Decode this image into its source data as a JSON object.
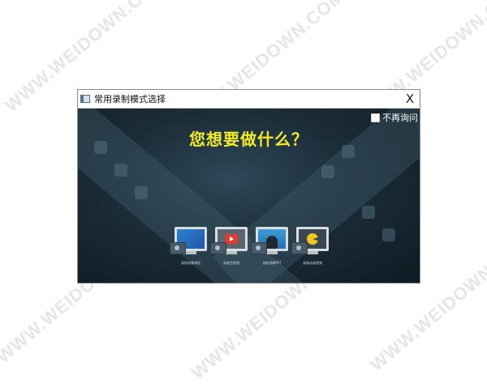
{
  "watermark": "WWW.WEIDOWN.COM",
  "window": {
    "title": "常用录制模式选择",
    "close_label": "X"
  },
  "content": {
    "dont_ask_label": "不再询问",
    "heading": "您想要做什么？",
    "options": [
      {
        "label": "录制屏幕课程",
        "icon": "screen-capture-icon"
      },
      {
        "label": "录制音视频",
        "icon": "video-play-icon"
      },
      {
        "label": "录制讲解PPT",
        "icon": "presenter-icon"
      },
      {
        "label": "录制动画视频",
        "icon": "animation-icon"
      }
    ]
  },
  "colors": {
    "heading": "#f3ea2a",
    "background": "#1c2d38"
  }
}
